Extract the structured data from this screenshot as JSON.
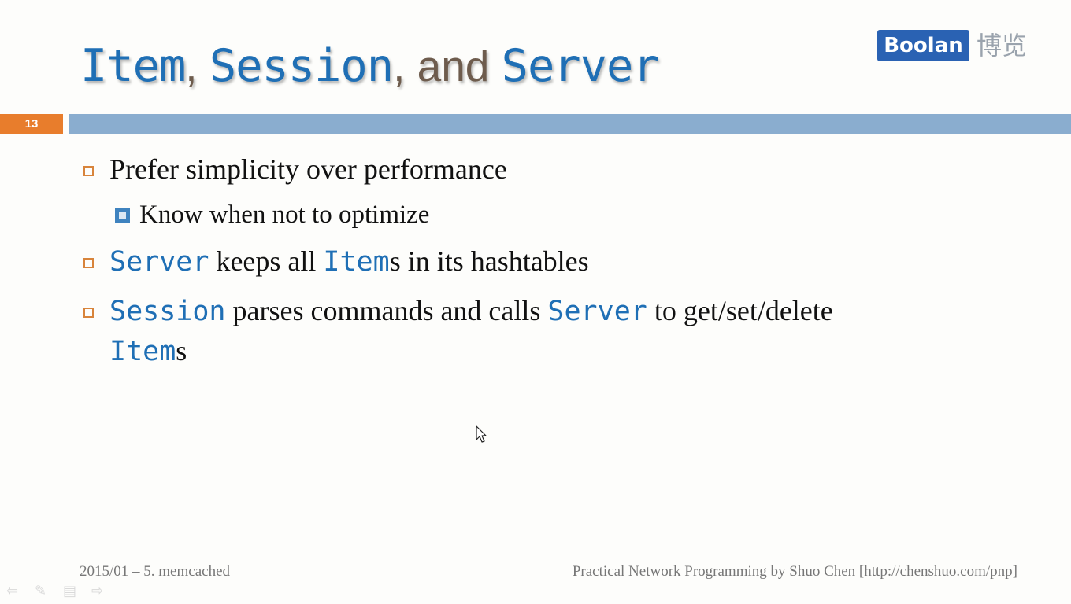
{
  "title": {
    "part1": "Item",
    "sep1": ", ",
    "part2": "Session",
    "sep2": ", and ",
    "part3": "Server"
  },
  "logo": {
    "brand": "Boolan",
    "cn": "博览"
  },
  "slide_number": "13",
  "bullets": [
    {
      "text": "Prefer simplicity over performance"
    },
    {
      "text": "Know when not to optimize"
    },
    {
      "code1": "Server",
      "t1": " keeps all ",
      "code2": "Item",
      "t2": "s in its hashtables"
    },
    {
      "code1": "Session",
      "t1": " parses commands and calls ",
      "code2": "Server",
      "t2": " to get/set/delete",
      "code3": "Item",
      "t3": "s"
    }
  ],
  "footer": {
    "left": "2015/01 – 5. memcached",
    "right": "Practical Network Programming by Shuo Chen [http://chenshuo.com/pnp]"
  },
  "icons": [
    "arrow-left-icon",
    "pen-icon",
    "menu-icon",
    "arrow-right-icon",
    "mouse-cursor-icon"
  ],
  "colors": {
    "accent_blue": "#1f6fb5",
    "bar_blue": "#8aadcf",
    "orange": "#e87d2c"
  }
}
